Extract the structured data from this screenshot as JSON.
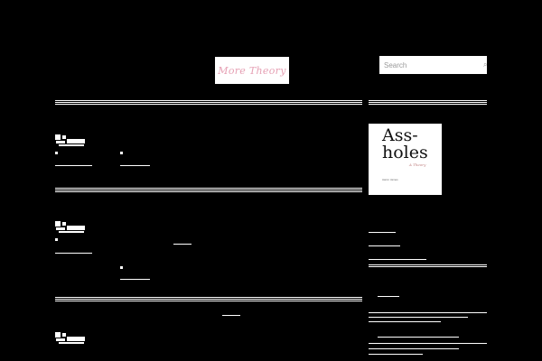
{
  "header": {
    "logo_text": "More Theory",
    "search": {
      "placeholder": "Search"
    },
    "icons": {
      "search": "magnifier-icon"
    }
  },
  "sidebar": {
    "book": {
      "title_line1": "Ass-",
      "title_line2": "holes",
      "subtitle": "A Theory",
      "author": "Aaron James"
    }
  },
  "colors": {
    "background": "#000000",
    "foreground": "#ffffff",
    "logo_accent": "#e6a0b4"
  }
}
